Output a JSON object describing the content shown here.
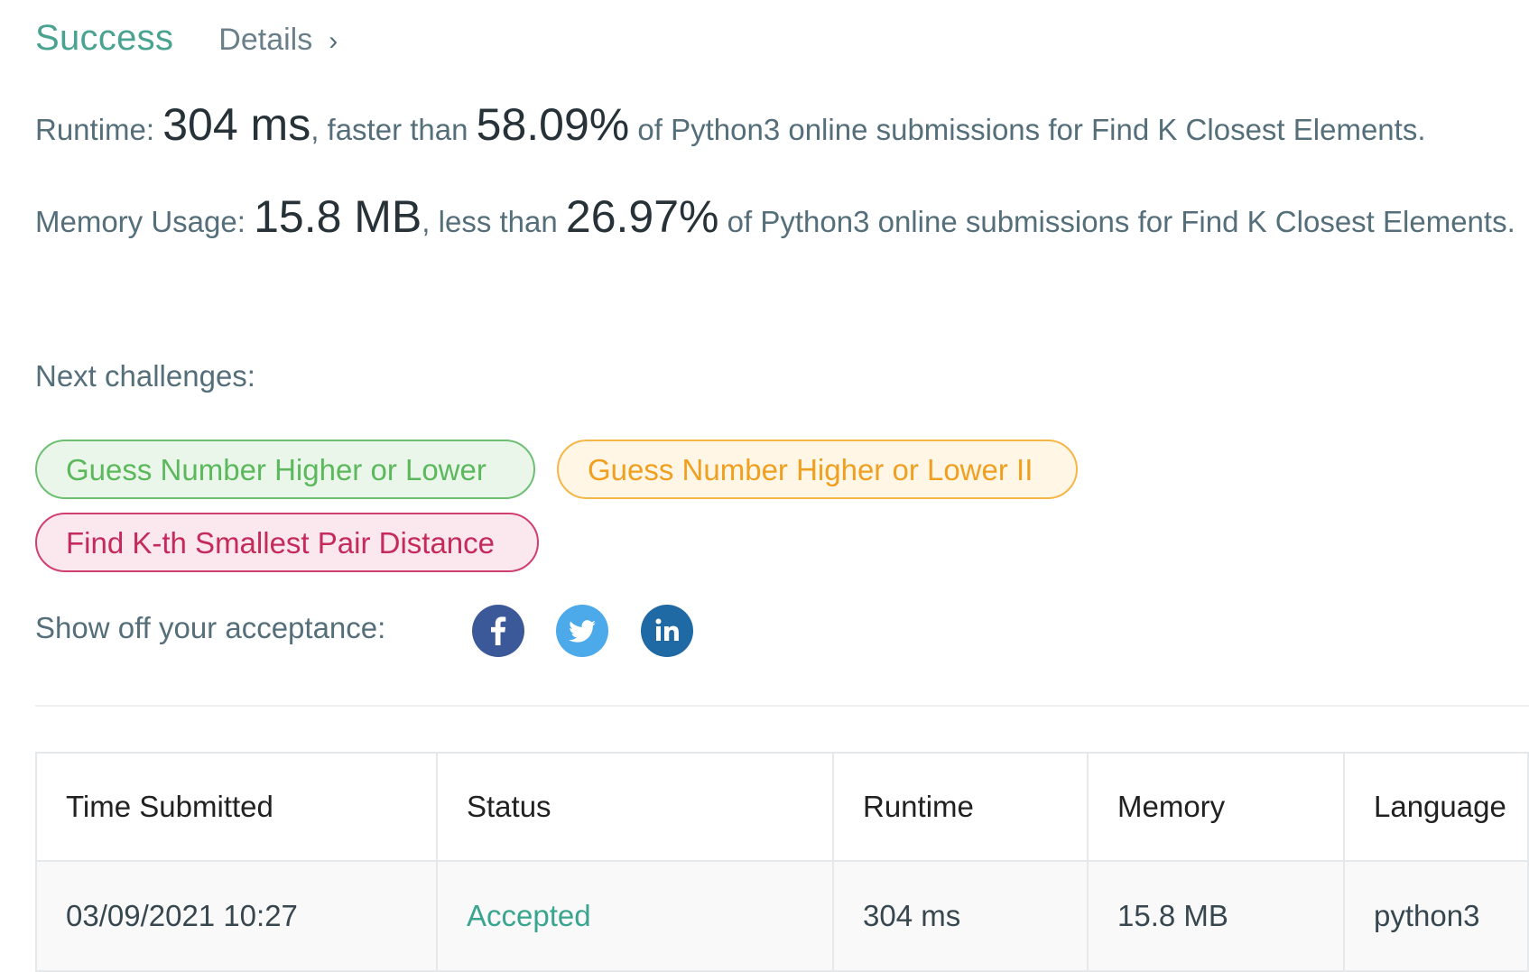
{
  "header": {
    "status_title": "Success",
    "details_link": "Details",
    "details_chevron": "›"
  },
  "runtime": {
    "label": "Runtime:",
    "value": "304 ms",
    "comparison_text": ", faster than",
    "percentile": "58.09%",
    "suffix": "of Python3 online submissions for Find K Closest Elements."
  },
  "memory": {
    "label": "Memory Usage:",
    "value": "15.8 MB",
    "comparison_text": ", less than",
    "percentile": "26.97%",
    "suffix": "of Python3 online submissions for Find K Closest Elements."
  },
  "next_challenges": {
    "label": "Next challenges:",
    "items": [
      {
        "label": "Guess Number Higher or Lower",
        "difficulty_color": "#5cb85c"
      },
      {
        "label": "Guess Number Higher or Lower II",
        "difficulty_color": "#f0a020"
      },
      {
        "label": "Find K-th Smallest Pair Distance",
        "difficulty_color": "#c52a5c"
      }
    ]
  },
  "share": {
    "label": "Show off your acceptance:",
    "icons": [
      "facebook-icon",
      "twitter-icon",
      "linkedin-icon"
    ],
    "colors": {
      "facebook": "#3b5998",
      "twitter": "#4ca9ea",
      "linkedin": "#1f6aa5"
    }
  },
  "submissions_table": {
    "columns": [
      "Time Submitted",
      "Status",
      "Runtime",
      "Memory",
      "Language"
    ],
    "rows": [
      [
        "03/09/2021 10:27",
        "Accepted",
        "304 ms",
        "15.8 MB",
        "python3"
      ]
    ]
  },
  "colors": {
    "success": "#4aa391",
    "accepted": "#3aa58f",
    "text_muted": "#546e7a",
    "text_strong": "#263238"
  }
}
